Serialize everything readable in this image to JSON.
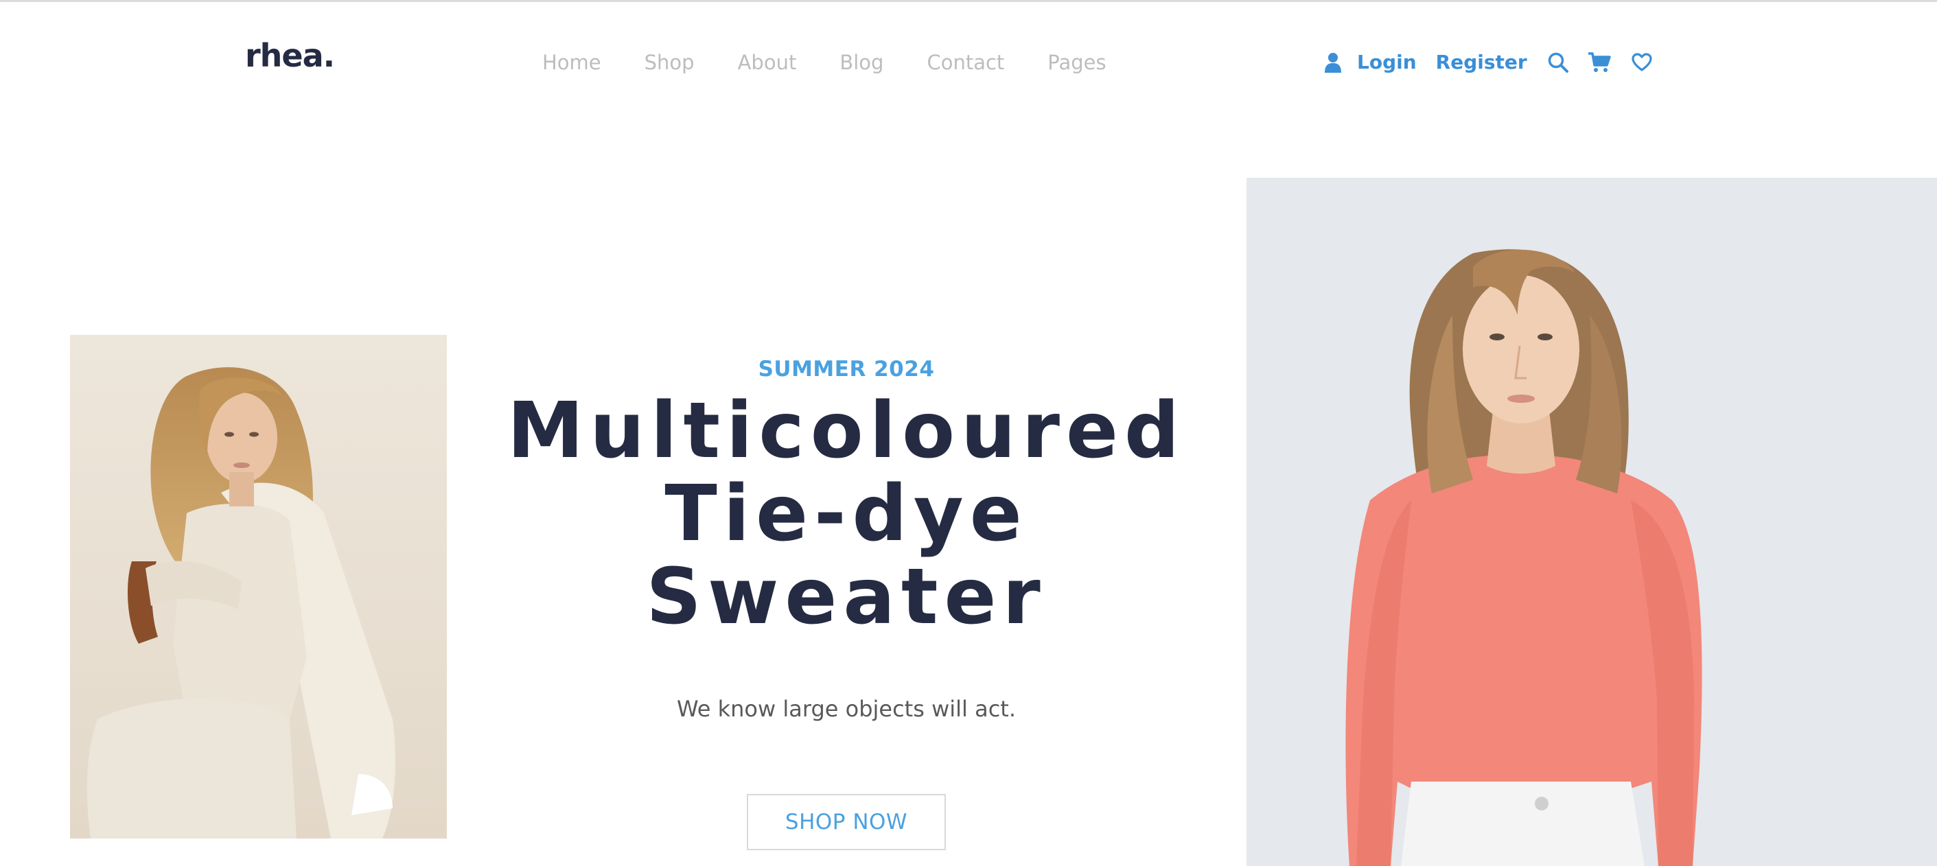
{
  "header": {
    "logo": "rhea.",
    "nav": [
      {
        "label": "Home"
      },
      {
        "label": "Shop"
      },
      {
        "label": "About"
      },
      {
        "label": "Blog"
      },
      {
        "label": "Contact"
      },
      {
        "label": "Pages"
      }
    ],
    "actions": {
      "user_icon": "user-icon",
      "login_label": "Login",
      "register_label": "Register",
      "search_icon": "search-icon",
      "cart_icon": "cart-icon",
      "wishlist_icon": "heart-icon"
    }
  },
  "hero": {
    "eyebrow": "SUMMER 2024",
    "headline_lines": [
      "Multicoloured",
      "Tie-dye",
      "Sweater"
    ],
    "subtext": "We know large objects will act.",
    "cta_label": "SHOP NOW"
  },
  "colors": {
    "primary_text": "#252b42",
    "accent_blue": "#4aa1e0",
    "nav_muted": "#bdbdbd",
    "body_gray": "#595959"
  }
}
